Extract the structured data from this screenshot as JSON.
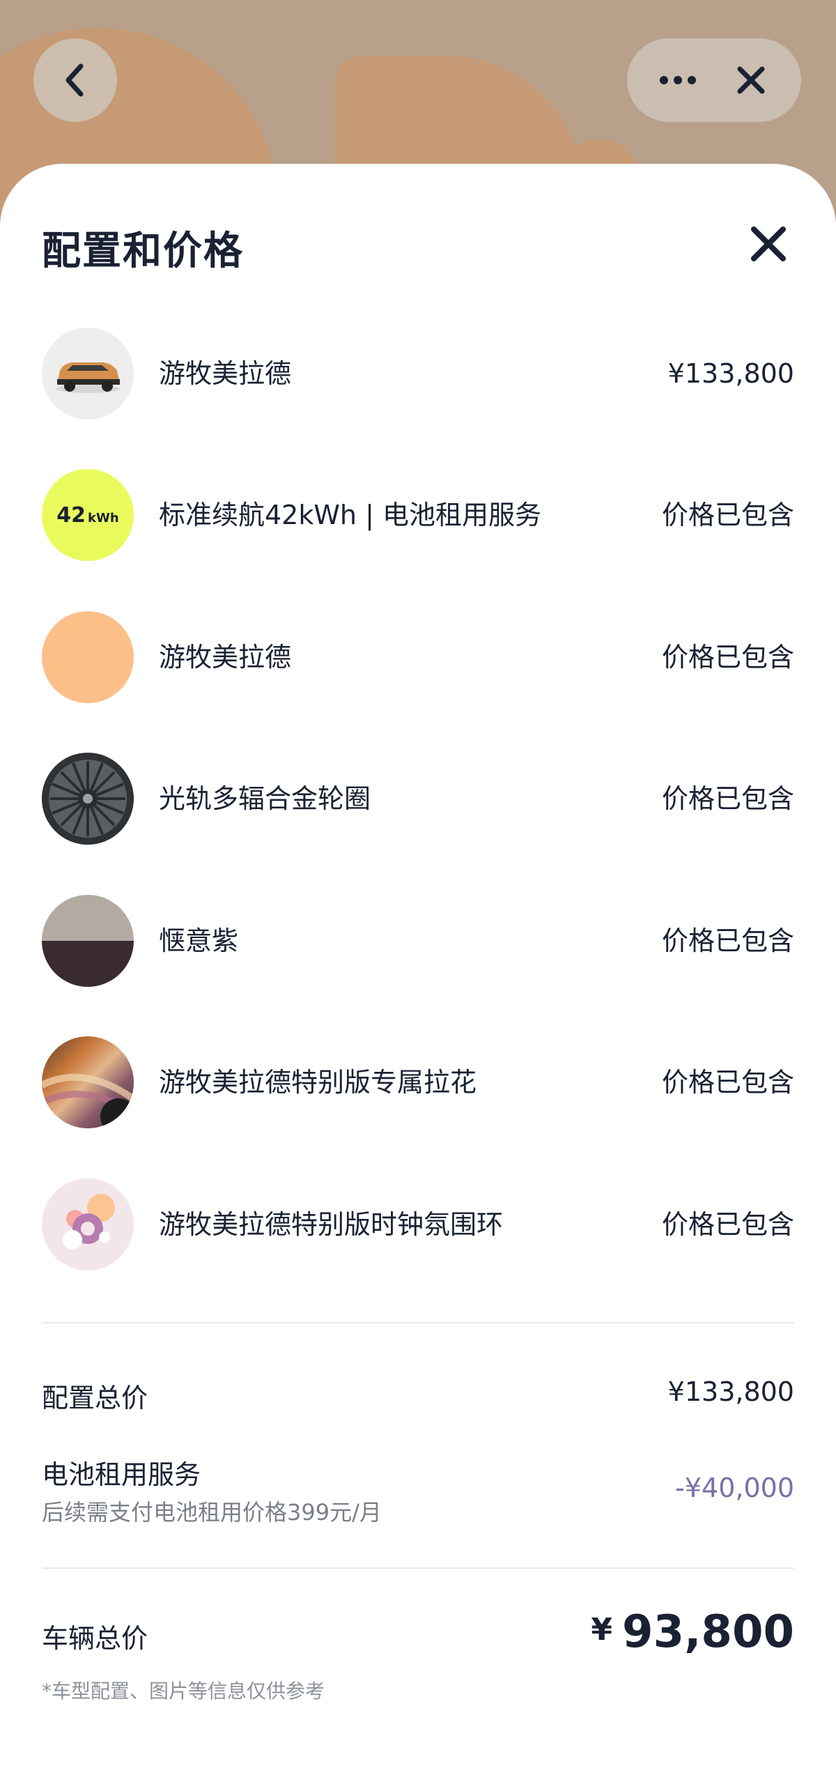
{
  "sheet": {
    "title": "配置和价格"
  },
  "items": [
    {
      "label": "游牧美拉德",
      "price": "¥133,800",
      "thumb": "car-image"
    },
    {
      "label": "标准续航42kWh | 电池租用服务",
      "price": "价格已包含",
      "thumb": "battery-badge",
      "badge_num": "42",
      "badge_unit": "kWh"
    },
    {
      "label": "游牧美拉德",
      "price": "价格已包含",
      "thumb": "color-swatch"
    },
    {
      "label": "光轨多辐合金轮圈",
      "price": "价格已包含",
      "thumb": "wheel-image"
    },
    {
      "label": "惬意紫",
      "price": "价格已包含",
      "thumb": "interior-swatch"
    },
    {
      "label": "游牧美拉德特别版专属拉花",
      "price": "价格已包含",
      "thumb": "decal-image"
    },
    {
      "label": "游牧美拉德特别版时钟氛围环",
      "price": "价格已包含",
      "thumb": "ambient-ring-image"
    }
  ],
  "summary": {
    "config_total_label": "配置总价",
    "config_total_value": "¥133,800",
    "battery_label": "电池租用服务",
    "battery_note": "后续需支付电池租用价格399元/月",
    "battery_value": "-¥40,000",
    "vehicle_total_label": "车辆总价",
    "vehicle_total_currency": "¥",
    "vehicle_total_value": "93,800",
    "disclaimer": "*车型配置、图片等信息仅供参考"
  },
  "colors": {
    "text_primary": "#1a2133",
    "discount": "#7c6fa8",
    "battery_badge": "#e9fb5c",
    "swatch_orange": "#fdbf88"
  }
}
